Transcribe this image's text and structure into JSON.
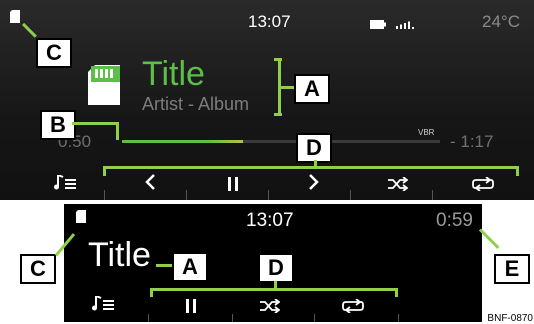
{
  "top": {
    "time": "13:07",
    "temperature": "24°C",
    "title": "Title",
    "subtitle": "Artist - Album",
    "elapsed": "0:50",
    "remaining": "- 1:17",
    "format": "VBR",
    "progress_fraction": 0.38
  },
  "bottom": {
    "time": "13:07",
    "elapsed": "0:59",
    "title": "Title"
  },
  "callouts": {
    "a": "A",
    "b": "B",
    "c": "C",
    "d": "D",
    "e": "E"
  },
  "reference_code": "BNF-0870",
  "colors": {
    "accent": "#5cbf47",
    "callout_line": "#8fd04a"
  },
  "icons": {
    "source": "sd-card-icon",
    "playlist": "playlist-icon",
    "previous": "chevron-left-icon",
    "pause": "pause-icon",
    "next": "chevron-right-icon",
    "shuffle": "shuffle-icon",
    "repeat": "repeat-icon",
    "battery": "battery-icon",
    "signal": "signal-icon"
  }
}
